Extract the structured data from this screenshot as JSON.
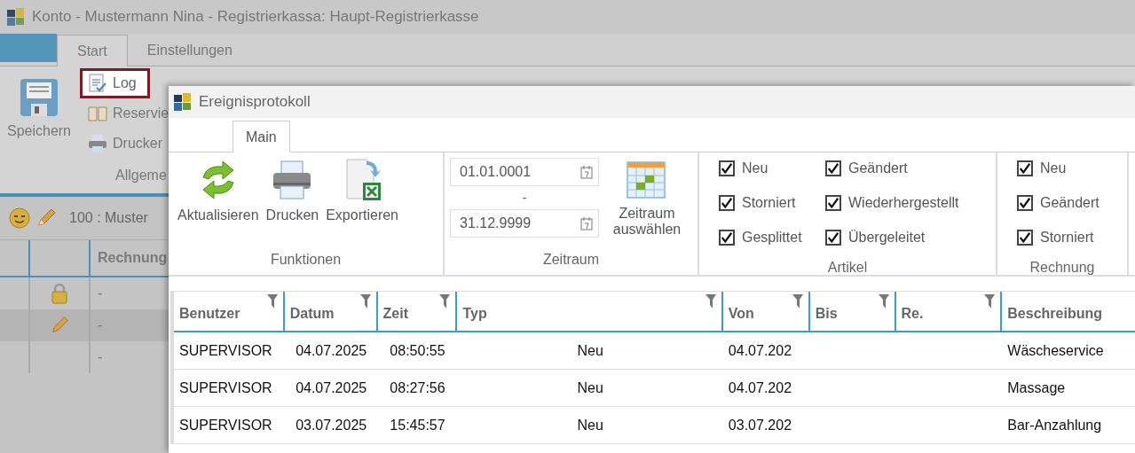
{
  "window": {
    "title": "Konto - Mustermann Nina - Registrierkassa: Haupt-Registrierkasse"
  },
  "tabs": [
    {
      "label": "Start",
      "selected": true
    },
    {
      "label": "Einstellungen",
      "selected": false
    }
  ],
  "ribbon": {
    "save": "Speichern",
    "items": [
      {
        "kind": "log",
        "label": "Log",
        "highlighted": true
      },
      {
        "kind": "book",
        "label": "Reservie",
        "highlighted": false
      },
      {
        "kind": "printer",
        "label": "Drucker",
        "highlighted": false
      }
    ],
    "group_label": "Allgeme"
  },
  "account_line": {
    "text": "100 :  Muster"
  },
  "grid": {
    "column_3": "Rechnung",
    "rows": [
      {
        "kind": "lock",
        "value": "-",
        "selected": false
      },
      {
        "kind": "pencil",
        "value": "-",
        "selected": true
      },
      {
        "kind": "none",
        "value": "-",
        "selected": false
      }
    ]
  },
  "dialog": {
    "title": "Ereignisprotokoll",
    "tabs": [
      {
        "label": "Main",
        "selected": true
      }
    ],
    "functions": {
      "buttons": [
        {
          "kind": "refresh",
          "label": "Aktualisieren"
        },
        {
          "kind": "printer",
          "label": "Drucken"
        },
        {
          "kind": "export",
          "label": "Exportieren"
        }
      ],
      "label": "Funktionen"
    },
    "period": {
      "from": "01.01.0001",
      "separator": "-",
      "to": "31.12.9999",
      "button": "Zeitraum auswählen",
      "label": "Zeitraum"
    },
    "article_filters": {
      "label": "Artikel",
      "options": [
        {
          "label": "Neu",
          "checked": true
        },
        {
          "label": "Storniert",
          "checked": true
        },
        {
          "label": "Gesplittet",
          "checked": true
        },
        {
          "label": "Geändert",
          "checked": true
        },
        {
          "label": "Wiederhergestellt",
          "checked": true
        },
        {
          "label": "Übergeleitet",
          "checked": true
        }
      ]
    },
    "invoice_filters": {
      "label": "Rechnung",
      "options": [
        {
          "label": "Neu",
          "checked": true
        },
        {
          "label": "Geändert",
          "checked": true
        },
        {
          "label": "Storniert",
          "checked": true
        }
      ]
    },
    "table": {
      "columns": [
        {
          "label": "Benutzer",
          "filter": true
        },
        {
          "label": "Datum",
          "filter": true
        },
        {
          "label": "Zeit",
          "filter": true
        },
        {
          "label": "Typ",
          "filter": true
        },
        {
          "label": "Von",
          "filter": true
        },
        {
          "label": "Bis",
          "filter": true
        },
        {
          "label": "Re.",
          "filter": true
        },
        {
          "label": "Beschreibung",
          "filter": false
        }
      ],
      "rows": [
        {
          "cells": [
            "SUPERVISOR",
            "04.07.2025",
            "08:50:55",
            "Neu",
            "04.07.202",
            "",
            "",
            "Wäscheservice"
          ]
        },
        {
          "cells": [
            "SUPERVISOR",
            "04.07.2025",
            "08:27:56",
            "Neu",
            "04.07.202",
            "",
            "",
            "Massage"
          ]
        },
        {
          "cells": [
            "SUPERVISOR",
            "03.07.2025",
            "15:45:57",
            "Neu",
            "03.07.202",
            "",
            "",
            "Bar-Anzahlung"
          ]
        }
      ]
    }
  }
}
